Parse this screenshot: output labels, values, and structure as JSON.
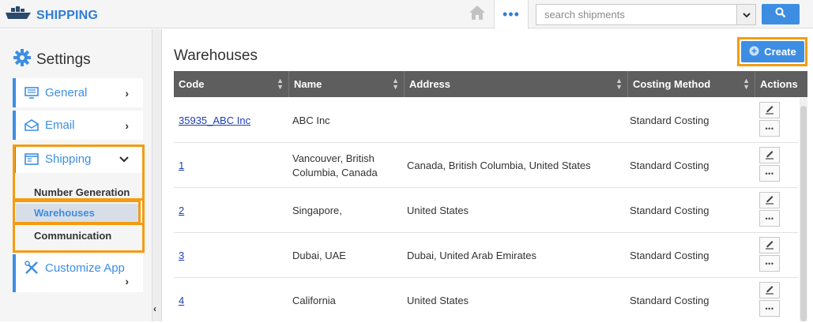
{
  "app": {
    "brand": "SHIPPING"
  },
  "topbar": {
    "search_placeholder": "search shipments",
    "more_label": "•••"
  },
  "sidebar": {
    "title": "Settings",
    "items": [
      {
        "label": "General",
        "chevron": "›"
      },
      {
        "label": "Email",
        "chevron": "›"
      },
      {
        "label": "Shipping",
        "chevron": "⌄"
      },
      {
        "label": "Customize App",
        "chevron": "›"
      }
    ],
    "shipping_subitems": [
      {
        "label": "Number Generation"
      },
      {
        "label": "Warehouses"
      },
      {
        "label": "Communication"
      }
    ],
    "collapse_label": "‹"
  },
  "main": {
    "title": "Warehouses",
    "create_label": "Create",
    "columns": [
      "Code",
      "Name",
      "Address",
      "Costing Method",
      "Actions"
    ],
    "rows": [
      {
        "code": "35935_ABC Inc",
        "name": "ABC Inc",
        "address": "",
        "costing": "Standard Costing"
      },
      {
        "code": "1",
        "name": "Vancouver, British Columbia, Canada",
        "address": "Canada, British Columbia, United States",
        "costing": "Standard Costing"
      },
      {
        "code": "2",
        "name": "Singapore,",
        "address": "United States",
        "costing": "Standard Costing"
      },
      {
        "code": "3",
        "name": "Dubai, UAE",
        "address": "Dubai, United Arab Emirates",
        "costing": "Standard Costing"
      },
      {
        "code": "4",
        "name": "California",
        "address": "United States",
        "costing": "Standard Costing"
      }
    ],
    "row_more_label": "•••"
  },
  "colors": {
    "accent": "#3d8ee3",
    "highlight": "#f39c12",
    "table_header": "#5e5e5e",
    "link": "#1f3fb5"
  }
}
